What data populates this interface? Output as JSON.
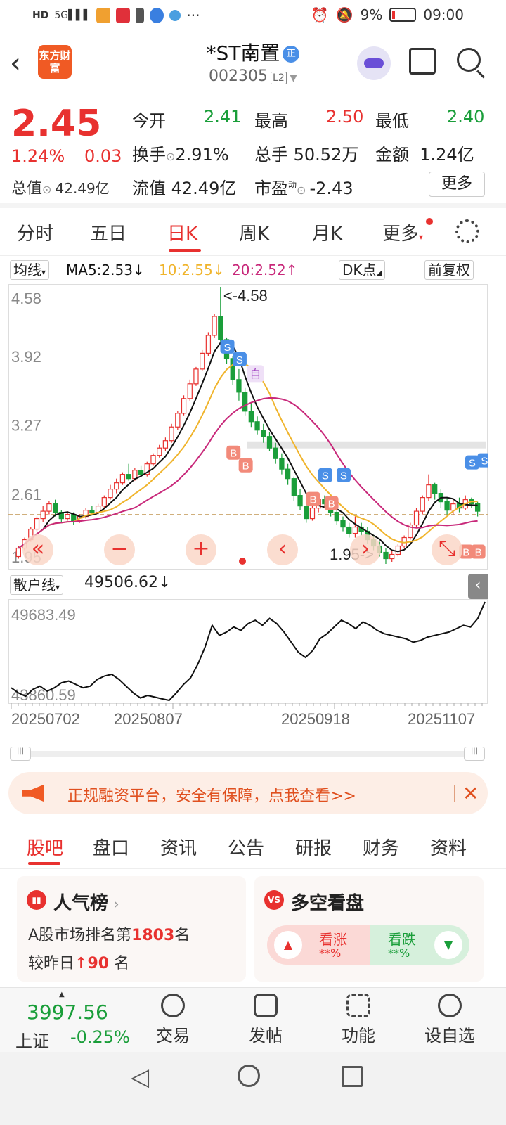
{
  "statusbar": {
    "battery": "9%",
    "time": "09:00"
  },
  "header": {
    "logo": "东方财富",
    "stock_name": "*ST南置",
    "badge": "正",
    "code": "002305",
    "level": "L2"
  },
  "quote": {
    "price": "2.45",
    "change_pct": "1.24%",
    "change_amt": "0.03",
    "open_label": "今开",
    "open": "2.41",
    "high_label": "最高",
    "high": "2.50",
    "low_label": "最低",
    "low": "2.40",
    "turnover_label": "换手",
    "turnover": "2.91%",
    "volume_label": "总手",
    "volume": "50.52万",
    "amount_label": "金额",
    "amount": "1.24亿",
    "mktcap_label": "总值",
    "mktcap": "42.49亿",
    "float_label": "流值",
    "float": "42.49亿",
    "pe_label": "市盈",
    "pe_sup": "动",
    "pe": "-2.43",
    "more": "更多"
  },
  "tabs": [
    "分时",
    "五日",
    "日K",
    "周K",
    "月K",
    "更多"
  ],
  "ma": {
    "selector": "均线",
    "ma5": "MA5:2.53↓",
    "ma10": "10:2.55↓",
    "ma20": "20:2.52↑",
    "dk": "DK点",
    "adjust": "前复权"
  },
  "colors": {
    "up": "#e8312f",
    "down": "#1a9e3a",
    "ma5": "#111111",
    "ma10": "#f0b42c",
    "ma20": "#c8287a"
  },
  "chart_data": [
    {
      "type": "candlestick",
      "title": "日K",
      "y_ticks": [
        "4.58",
        "3.92",
        "3.27",
        "2.61",
        "1.95"
      ],
      "ylim": [
        1.95,
        4.58
      ],
      "annotations": [
        "<-4.58",
        "1.95->"
      ],
      "markers": [
        "S",
        "S",
        "S",
        "S",
        "S",
        "S",
        "自",
        "B",
        "B",
        "B",
        "B",
        "B",
        "B"
      ],
      "reference_price": 2.42,
      "candles": [
        {
          "o": 2.02,
          "c": 2.1,
          "h": 2.12,
          "l": 2.0
        },
        {
          "o": 2.1,
          "c": 2.18,
          "h": 2.2,
          "l": 2.08
        },
        {
          "o": 2.18,
          "c": 2.28,
          "h": 2.3,
          "l": 2.16
        },
        {
          "o": 2.28,
          "c": 2.38,
          "h": 2.4,
          "l": 2.26
        },
        {
          "o": 2.38,
          "c": 2.45,
          "h": 2.5,
          "l": 2.35
        },
        {
          "o": 2.45,
          "c": 2.52,
          "h": 2.55,
          "l": 2.42
        },
        {
          "o": 2.52,
          "c": 2.44,
          "h": 2.56,
          "l": 2.4
        },
        {
          "o": 2.44,
          "c": 2.38,
          "h": 2.46,
          "l": 2.35
        },
        {
          "o": 2.38,
          "c": 2.42,
          "h": 2.45,
          "l": 2.36
        },
        {
          "o": 2.42,
          "c": 2.36,
          "h": 2.44,
          "l": 2.32
        },
        {
          "o": 2.36,
          "c": 2.4,
          "h": 2.42,
          "l": 2.34
        },
        {
          "o": 2.4,
          "c": 2.46,
          "h": 2.48,
          "l": 2.38
        },
        {
          "o": 2.46,
          "c": 2.44,
          "h": 2.5,
          "l": 2.42
        },
        {
          "o": 2.44,
          "c": 2.5,
          "h": 2.52,
          "l": 2.42
        },
        {
          "o": 2.5,
          "c": 2.58,
          "h": 2.6,
          "l": 2.48
        },
        {
          "o": 2.58,
          "c": 2.66,
          "h": 2.7,
          "l": 2.56
        },
        {
          "o": 2.66,
          "c": 2.72,
          "h": 2.76,
          "l": 2.62
        },
        {
          "o": 2.72,
          "c": 2.8,
          "h": 2.82,
          "l": 2.7
        },
        {
          "o": 2.8,
          "c": 2.76,
          "h": 2.9,
          "l": 2.74
        },
        {
          "o": 2.76,
          "c": 2.84,
          "h": 2.86,
          "l": 2.74
        },
        {
          "o": 2.84,
          "c": 2.8,
          "h": 2.88,
          "l": 2.78
        },
        {
          "o": 2.8,
          "c": 2.9,
          "h": 2.92,
          "l": 2.78
        },
        {
          "o": 2.9,
          "c": 2.98,
          "h": 3.0,
          "l": 2.88
        },
        {
          "o": 2.98,
          "c": 3.05,
          "h": 3.08,
          "l": 2.96
        },
        {
          "o": 3.05,
          "c": 3.12,
          "h": 3.15,
          "l": 3.02
        },
        {
          "o": 3.12,
          "c": 3.25,
          "h": 3.28,
          "l": 3.1
        },
        {
          "o": 3.25,
          "c": 3.38,
          "h": 3.4,
          "l": 3.22
        },
        {
          "o": 3.38,
          "c": 3.52,
          "h": 3.55,
          "l": 3.36
        },
        {
          "o": 3.52,
          "c": 3.66,
          "h": 3.7,
          "l": 3.5
        },
        {
          "o": 3.66,
          "c": 3.8,
          "h": 3.82,
          "l": 3.64
        },
        {
          "o": 3.8,
          "c": 3.95,
          "h": 3.98,
          "l": 3.78
        },
        {
          "o": 3.95,
          "c": 4.12,
          "h": 4.15,
          "l": 3.92
        },
        {
          "o": 4.12,
          "c": 4.3,
          "h": 4.32,
          "l": 4.1
        },
        {
          "o": 4.3,
          "c": 4.08,
          "h": 4.58,
          "l": 4.05
        },
        {
          "o": 4.08,
          "c": 3.9,
          "h": 4.1,
          "l": 3.85
        },
        {
          "o": 3.9,
          "c": 3.7,
          "h": 3.92,
          "l": 3.65
        },
        {
          "o": 3.7,
          "c": 3.58,
          "h": 3.8,
          "l": 3.5
        },
        {
          "o": 3.58,
          "c": 3.4,
          "h": 3.62,
          "l": 3.36
        },
        {
          "o": 3.4,
          "c": 3.3,
          "h": 3.48,
          "l": 3.25
        },
        {
          "o": 3.3,
          "c": 3.22,
          "h": 3.35,
          "l": 3.18
        },
        {
          "o": 3.22,
          "c": 3.16,
          "h": 3.28,
          "l": 3.1
        },
        {
          "o": 3.16,
          "c": 3.05,
          "h": 3.2,
          "l": 3.02
        },
        {
          "o": 3.05,
          "c": 2.95,
          "h": 3.1,
          "l": 2.9
        },
        {
          "o": 2.95,
          "c": 2.85,
          "h": 3.0,
          "l": 2.8
        },
        {
          "o": 2.85,
          "c": 2.76,
          "h": 2.9,
          "l": 2.7
        },
        {
          "o": 2.76,
          "c": 2.6,
          "h": 2.78,
          "l": 2.55
        },
        {
          "o": 2.6,
          "c": 2.5,
          "h": 2.66,
          "l": 2.46
        },
        {
          "o": 2.5,
          "c": 2.38,
          "h": 2.55,
          "l": 2.34
        },
        {
          "o": 2.38,
          "c": 2.48,
          "h": 2.54,
          "l": 2.36
        },
        {
          "o": 2.48,
          "c": 2.56,
          "h": 2.6,
          "l": 2.44
        },
        {
          "o": 2.56,
          "c": 2.52,
          "h": 2.6,
          "l": 2.48
        },
        {
          "o": 2.52,
          "c": 2.44,
          "h": 2.55,
          "l": 2.4
        },
        {
          "o": 2.44,
          "c": 2.36,
          "h": 2.46,
          "l": 2.32
        },
        {
          "o": 2.36,
          "c": 2.3,
          "h": 2.4,
          "l": 2.26
        },
        {
          "o": 2.3,
          "c": 2.24,
          "h": 2.34,
          "l": 2.2
        },
        {
          "o": 2.24,
          "c": 2.3,
          "h": 2.4,
          "l": 2.2
        },
        {
          "o": 2.3,
          "c": 2.26,
          "h": 2.34,
          "l": 2.22
        },
        {
          "o": 2.26,
          "c": 2.18,
          "h": 2.3,
          "l": 2.14
        },
        {
          "o": 2.18,
          "c": 2.12,
          "h": 2.22,
          "l": 2.08
        },
        {
          "o": 2.12,
          "c": 2.06,
          "h": 2.16,
          "l": 2.02
        },
        {
          "o": 2.06,
          "c": 2.0,
          "h": 2.1,
          "l": 1.95
        },
        {
          "o": 2.0,
          "c": 2.04,
          "h": 2.08,
          "l": 1.97
        },
        {
          "o": 2.04,
          "c": 2.12,
          "h": 2.14,
          "l": 2.02
        },
        {
          "o": 2.12,
          "c": 2.2,
          "h": 2.22,
          "l": 2.1
        },
        {
          "o": 2.2,
          "c": 2.32,
          "h": 2.34,
          "l": 2.18
        },
        {
          "o": 2.32,
          "c": 2.45,
          "h": 2.48,
          "l": 2.3
        },
        {
          "o": 2.45,
          "c": 2.58,
          "h": 2.6,
          "l": 2.42
        },
        {
          "o": 2.58,
          "c": 2.7,
          "h": 2.8,
          "l": 2.55
        },
        {
          "o": 2.7,
          "c": 2.62,
          "h": 2.72,
          "l": 2.56
        },
        {
          "o": 2.62,
          "c": 2.54,
          "h": 2.66,
          "l": 2.48
        },
        {
          "o": 2.54,
          "c": 2.46,
          "h": 2.58,
          "l": 2.42
        },
        {
          "o": 2.46,
          "c": 2.52,
          "h": 2.56,
          "l": 2.42
        },
        {
          "o": 2.52,
          "c": 2.48,
          "h": 2.58,
          "l": 2.44
        },
        {
          "o": 2.48,
          "c": 2.56,
          "h": 2.6,
          "l": 2.46
        },
        {
          "o": 2.56,
          "c": 2.52,
          "h": 2.58,
          "l": 2.48
        },
        {
          "o": 2.52,
          "c": 2.45,
          "h": 2.54,
          "l": 2.4
        }
      ]
    },
    {
      "type": "line",
      "title": "散户线",
      "value_label": "49506.62↓",
      "y_ticks": [
        "49683.49",
        "43860.59"
      ],
      "ylim": [
        43860.59,
        49683.49
      ],
      "x_ticks": [
        "20250702",
        "20250807",
        "20250918",
        "20251107"
      ],
      "values": [
        44600,
        44300,
        44100,
        44500,
        44700,
        44400,
        44600,
        44900,
        45000,
        44800,
        44600,
        44700,
        45100,
        45300,
        45400,
        45100,
        44700,
        44300,
        44000,
        44150,
        44050,
        43950,
        43860.59,
        44300,
        44800,
        45200,
        46000,
        47000,
        48300,
        47700,
        47900,
        48200,
        48000,
        48400,
        48600,
        48300,
        48700,
        48400,
        47900,
        47300,
        46700,
        46400,
        46800,
        47500,
        47800,
        48200,
        48600,
        48400,
        48100,
        48500,
        48300,
        48000,
        47800,
        47700,
        47600,
        47500,
        47300,
        47400,
        47600,
        47700,
        47800,
        47900,
        48100,
        48300,
        48200,
        48700,
        49683.49
      ]
    }
  ],
  "indicator": {
    "name": "散户线"
  },
  "banner": {
    "text": "正规融资平台，安全有保障，点我查看>>"
  },
  "bottom_tabs": [
    "股吧",
    "盘口",
    "资讯",
    "公告",
    "研报",
    "财务",
    "资料"
  ],
  "cards": {
    "popular": {
      "title": "人气榜",
      "line1_prefix": "A股市场排名第",
      "rank": "1803",
      "line1_suffix": "名",
      "line2_prefix": "较昨日",
      "change": "90",
      "line2_suffix": "名"
    },
    "bull_bear": {
      "title": "多空看盘",
      "up_label": "看涨",
      "up_val": "**%",
      "down_label": "看跌",
      "down_val": "**%"
    }
  },
  "bottom_nav": {
    "index_value": "3997.56",
    "index_name": "上证",
    "index_change": "-0.25%",
    "items": [
      "交易",
      "发帖",
      "功能",
      "设自选"
    ]
  }
}
